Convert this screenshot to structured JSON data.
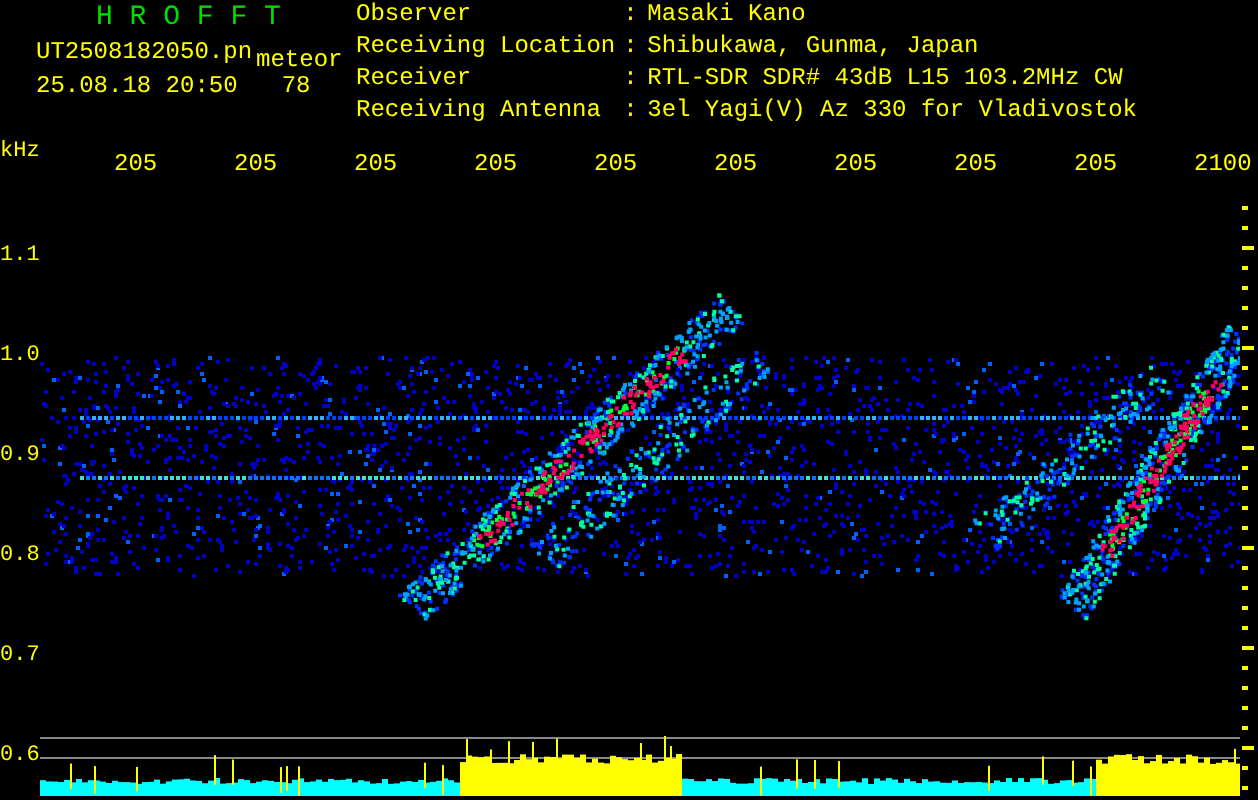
{
  "header": {
    "title": "H R O F F T",
    "file_name": "UT2508182050.pn",
    "mode": "meteor",
    "timestamp": "25.08.18 20:50",
    "count": "78"
  },
  "info": [
    {
      "label": "Observer",
      "separator": ":",
      "value": "Masaki Kano"
    },
    {
      "label": "Receiving Location",
      "separator": ":",
      "value": "Shibukawa, Gunma, Japan"
    },
    {
      "label": "Receiver",
      "separator": ":",
      "value": "RTL-SDR SDR# 43dB L15 103.2MHz CW"
    },
    {
      "label": "Receiving Antenna",
      "separator": ":",
      "value": "3el Yagi(V) Az 330 for Vladivostok"
    }
  ],
  "x_axis": {
    "labels": [
      "205",
      "205",
      "205",
      "205",
      "205",
      "205",
      "205",
      "205",
      "205",
      "2100"
    ]
  },
  "y_axis": {
    "unit": "kHz",
    "labels": [
      "1.1",
      "1.0",
      "0.9",
      "0.8",
      "0.7",
      "0.6"
    ]
  }
}
